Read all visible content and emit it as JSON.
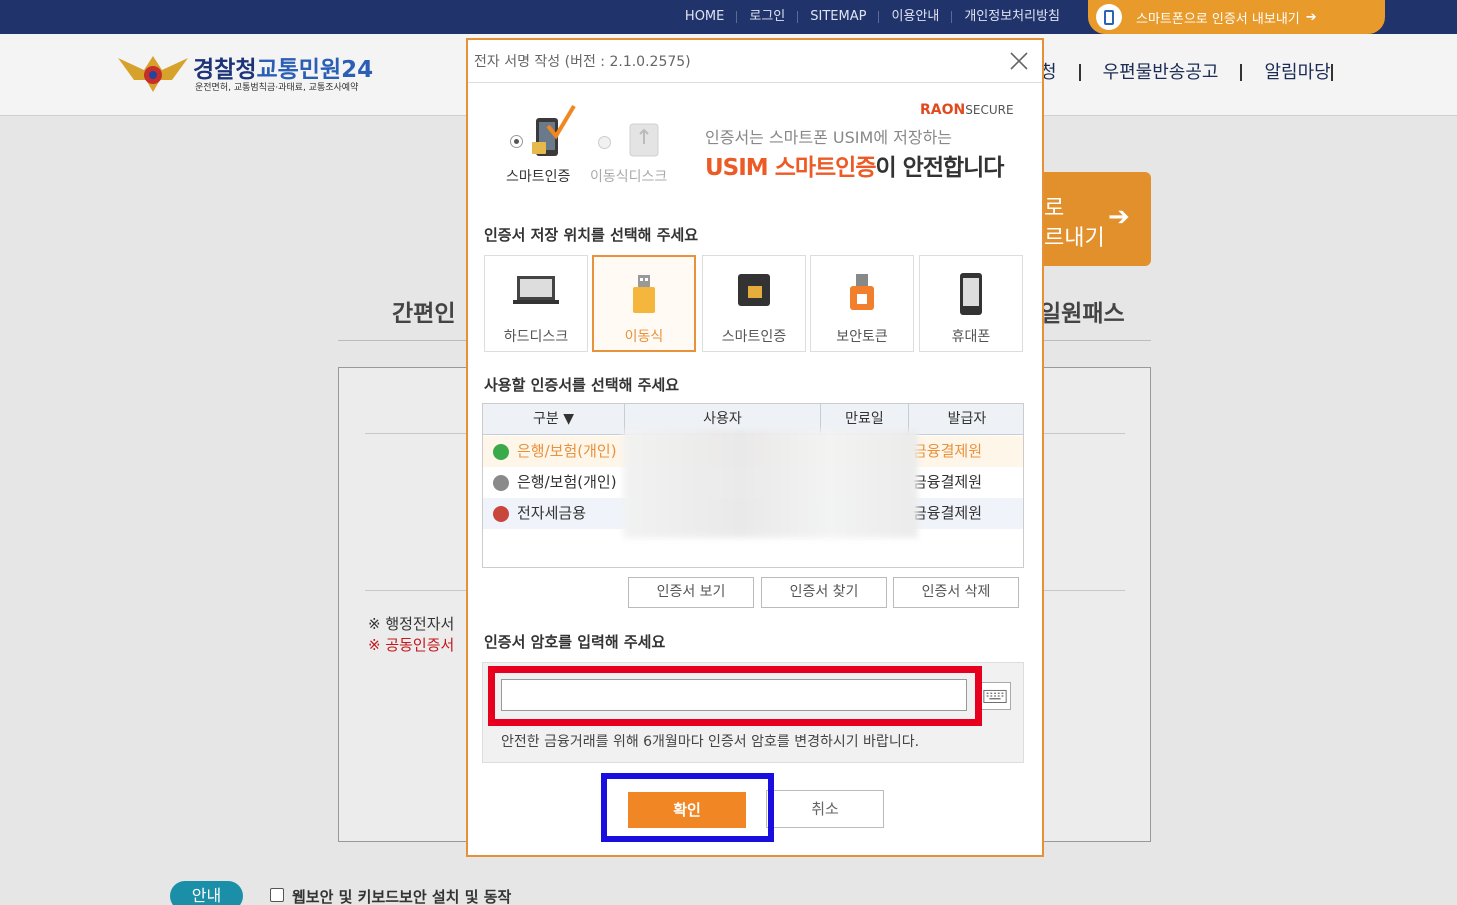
{
  "topbar": {
    "links": [
      "HOME",
      "로그인",
      "SITEMAP",
      "이용안내",
      "개인정보처리방침"
    ],
    "export_label": "스마트폰으로 인증서 내보내기"
  },
  "header": {
    "logo_title_a": "경찰청",
    "logo_title_b": "교통민원24",
    "logo_sub": "운전면허, 교통범칙금·과태료, 교통조사예약",
    "gnb": [
      "청",
      "우편물반송공고",
      "알림마당"
    ]
  },
  "background": {
    "orange_line1": "로",
    "orange_line2": "르내기",
    "tab_left": "간편인",
    "tab_right": "일원패스",
    "note1": "※ 행정전자서",
    "note2": "※ 공동인증서",
    "guide": "안내",
    "install_label": "웹보안 및 키보드보안 설치 및 동작"
  },
  "modal": {
    "title": "전자 서명 작성 (버전 : 2.1.0.2575)",
    "promo": {
      "opt_smart": "스마트인증",
      "opt_removable": "이동식디스크",
      "brand_a": "RA",
      "brand_b": "O",
      "brand_c": "N",
      "brand_d": "SECURE",
      "line1": "인증서는 스마트폰 USIM에 저장하는",
      "line2_a": "USIM 스마트인증",
      "line2_b": "이 안전합니다"
    },
    "location_label": "인증서 저장 위치를 선택해 주세요",
    "locations": [
      {
        "label": "하드디스크",
        "icon": "laptop-icon",
        "selected": false
      },
      {
        "label": "이동식",
        "icon": "usb-icon",
        "selected": true
      },
      {
        "label": "스마트인증",
        "icon": "sim-card-icon",
        "selected": false
      },
      {
        "label": "보안토큰",
        "icon": "token-icon",
        "selected": false
      },
      {
        "label": "휴대폰",
        "icon": "phone-icon",
        "selected": false
      }
    ],
    "cert_label": "사용할 인증서를 선택해 주세요",
    "columns": [
      "구분 ▼",
      "사용자",
      "만료일",
      "발급자"
    ],
    "rows": [
      {
        "type": "은행/보험(개인)",
        "issuer": "금융결제원"
      },
      {
        "type": "은행/보험(개인)",
        "issuer": "금융결제원"
      },
      {
        "type": "전자세금용",
        "issuer": "금융결제원"
      }
    ],
    "btn_view": "인증서 보기",
    "btn_find": "인증서 찾기",
    "btn_delete": "인증서 삭제",
    "password_label": "인증서 암호를 입력해 주세요",
    "password_value": "",
    "password_hint": "안전한 금융거래를 위해 6개월마다 인증서 암호를 변경하시기 바랍니다.",
    "ok": "확인",
    "cancel": "취소"
  },
  "colors": {
    "accent_orange": "#f08724",
    "highlight_red": "#e6001e",
    "highlight_blue": "#1a0ddf",
    "topbar_navy": "#21336b"
  }
}
